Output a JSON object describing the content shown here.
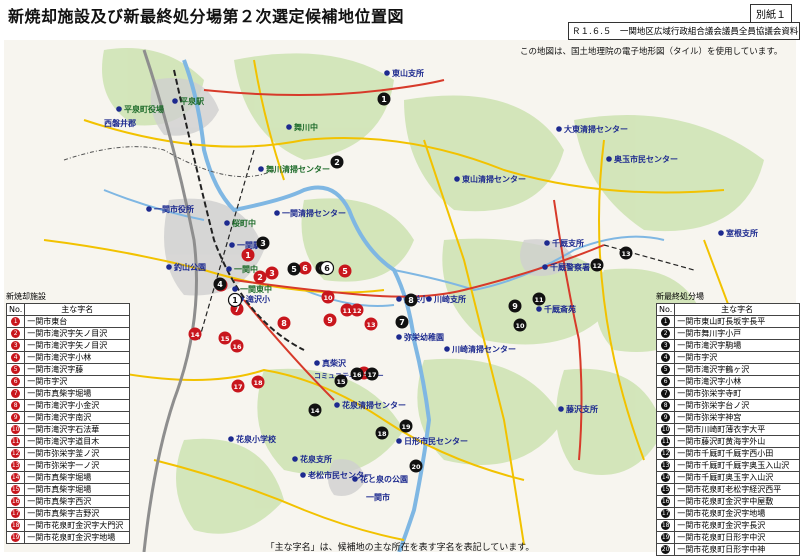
{
  "title": "新焼却施設及び新最終処分場第２次選定候補地位置図",
  "doc_id": "別紙１",
  "doc_source": "Ｒ１.６.５　一関地区広域行政組合議会議員全員協議会資料",
  "map_credit": "この地図は、国土地理院の電子地形図（タイル）を使用しています。",
  "footnote": "「主な字名」は、候補地の主な所在を表す字名を表記しています。",
  "colors": {
    "road_yellow": "#f2c200",
    "road_red": "#d73a2a",
    "road_black": "#222222",
    "river": "#7fb7e3",
    "forest": "#b9d99a",
    "urban": "#bfbfbf",
    "candidate_incineration": "#c8161d",
    "candidate_landfill": "#111111",
    "facility": "#1d2a8f",
    "label_green": "#1d6b2a"
  },
  "incineration_table": {
    "heading": "新焼却施設",
    "col_no": "No.",
    "col_name": "主な字名",
    "rows": [
      {
        "no": "1",
        "name": "一関市東台"
      },
      {
        "no": "2",
        "name": "一関市滝沢字矢ノ目沢"
      },
      {
        "no": "3",
        "name": "一関市滝沢字矢ノ目沢"
      },
      {
        "no": "4",
        "name": "一関市滝沢字小林"
      },
      {
        "no": "5",
        "name": "一関市滝沢字藤"
      },
      {
        "no": "6",
        "name": "一関市字沢"
      },
      {
        "no": "7",
        "name": "一関市真柴字堀場"
      },
      {
        "no": "8",
        "name": "一関市滝沢字小金沢"
      },
      {
        "no": "9",
        "name": "一関市滝沢字南沢"
      },
      {
        "no": "10",
        "name": "一関市滝沢字石法華"
      },
      {
        "no": "11",
        "name": "一関市滝沢字道目木"
      },
      {
        "no": "12",
        "name": "一関市弥栄字釜ノ沢"
      },
      {
        "no": "13",
        "name": "一関市弥栄字一ノ沢"
      },
      {
        "no": "14",
        "name": "一関市真柴字堀場"
      },
      {
        "no": "15",
        "name": "一関市真柴字堀場"
      },
      {
        "no": "16",
        "name": "一関市真柴字西沢"
      },
      {
        "no": "17",
        "name": "一関市真柴字吉野沢"
      },
      {
        "no": "18",
        "name": "一関市花泉町金沢字大門沢"
      },
      {
        "no": "19",
        "name": "一関市花泉町金沢字地場"
      }
    ]
  },
  "landfill_table": {
    "heading": "新最終処分場",
    "col_no": "No.",
    "col_name": "主な字名",
    "rows": [
      {
        "no": "1",
        "name": "一関市東山町長坂字長平"
      },
      {
        "no": "2",
        "name": "一関市舞川字小戸"
      },
      {
        "no": "3",
        "name": "一関市滝沢字駒場"
      },
      {
        "no": "4",
        "name": "一関市字沢"
      },
      {
        "no": "5",
        "name": "一関市滝沢字鶴ヶ沢"
      },
      {
        "no": "6",
        "name": "一関市滝沢字小林"
      },
      {
        "no": "7",
        "name": "一関市弥栄字寺町"
      },
      {
        "no": "8",
        "name": "一関市弥栄字台ノ沢"
      },
      {
        "no": "9",
        "name": "一関市弥栄字神宮"
      },
      {
        "no": "10",
        "name": "一関市川崎町薄衣字大平"
      },
      {
        "no": "11",
        "name": "一関市藤沢町黄海字外山"
      },
      {
        "no": "12",
        "name": "一関市千厩町千厩字西小田"
      },
      {
        "no": "13",
        "name": "一関市千厩町千厩字奥玉入山沢"
      },
      {
        "no": "14",
        "name": "一関市千厩町奥玉字入山沢"
      },
      {
        "no": "15",
        "name": "一関市花泉町老松字経沢西平"
      },
      {
        "no": "16",
        "name": "一関市花泉町金沢字中屋敷"
      },
      {
        "no": "17",
        "name": "一関市花泉町金沢字地場"
      },
      {
        "no": "18",
        "name": "一関市花泉町金沢字長沢"
      },
      {
        "no": "19",
        "name": "一関市花泉町日形字中沢"
      },
      {
        "no": "20",
        "name": "一関市花泉町日形字中神"
      }
    ]
  },
  "map": {
    "place_labels": [
      {
        "text": "平泉駅"
      },
      {
        "text": "平泉町役場"
      },
      {
        "text": "西磐井郡"
      },
      {
        "text": "東山支所"
      },
      {
        "text": "舞川中"
      },
      {
        "text": "舞川清掃センター"
      },
      {
        "text": "大東清掃センター"
      },
      {
        "text": "奥玉市民センター"
      },
      {
        "text": "東山清掃センター"
      },
      {
        "text": "一関市役所"
      },
      {
        "text": "桜町中"
      },
      {
        "text": "一関駅"
      },
      {
        "text": "釣山公園"
      },
      {
        "text": "一関中"
      },
      {
        "text": "一関東中"
      },
      {
        "text": "一関清掃センター"
      },
      {
        "text": "千厩支所"
      },
      {
        "text": "千厩警察署"
      },
      {
        "text": "室根支所"
      },
      {
        "text": "滝沢小"
      },
      {
        "text": "弥栄小"
      },
      {
        "text": "川崎支所"
      },
      {
        "text": "千厩斎苑"
      },
      {
        "text": "弥栄幼稚園"
      },
      {
        "text": "川崎清掃センター"
      },
      {
        "text": "真柴沢"
      },
      {
        "text": "コミュニティセンター"
      },
      {
        "text": "花泉清掃センター"
      },
      {
        "text": "藤沢支所"
      },
      {
        "text": "日形市民センター"
      },
      {
        "text": "花泉小学校"
      },
      {
        "text": "花泉支所"
      },
      {
        "text": "老松市民センター"
      },
      {
        "text": "花と泉の公園"
      },
      {
        "text": "一関市"
      }
    ],
    "incineration_markers": [
      "1",
      "2",
      "3",
      "4",
      "5",
      "6",
      "7",
      "8",
      "9",
      "10",
      "11",
      "12",
      "13",
      "14",
      "15",
      "16",
      "17",
      "18",
      "19"
    ],
    "landfill_markers": [
      "1",
      "2",
      "3",
      "4",
      "5",
      "6",
      "7",
      "8",
      "9",
      "10",
      "11",
      "12",
      "13",
      "14",
      "15",
      "16",
      "17",
      "18",
      "19",
      "20"
    ],
    "outline_markers": [
      "1",
      "6"
    ]
  }
}
